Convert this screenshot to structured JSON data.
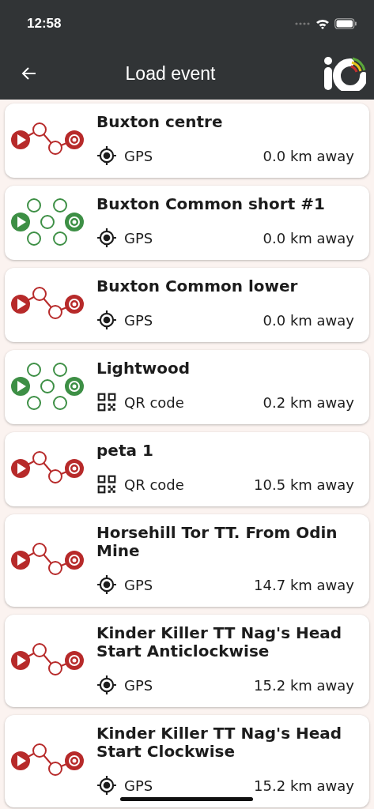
{
  "status_bar": {
    "time": "12:58"
  },
  "app_bar": {
    "title": "Load event"
  },
  "events": [
    {
      "kind": "linear",
      "name": "Buxton centre",
      "method": {
        "kind": "gps",
        "label": "GPS"
      },
      "distance": "0.0 km away"
    },
    {
      "kind": "score",
      "name": "Buxton Common short #1",
      "method": {
        "kind": "gps",
        "label": "GPS"
      },
      "distance": "0.0 km away"
    },
    {
      "kind": "linear",
      "name": "Buxton Common lower",
      "method": {
        "kind": "gps",
        "label": "GPS"
      },
      "distance": "0.0 km away"
    },
    {
      "kind": "score",
      "name": "Lightwood",
      "method": {
        "kind": "qr",
        "label": "QR code"
      },
      "distance": "0.2 km away"
    },
    {
      "kind": "linear",
      "name": "peta 1",
      "method": {
        "kind": "qr",
        "label": "QR code"
      },
      "distance": "10.5 km away"
    },
    {
      "kind": "linear",
      "name": "Horsehill Tor TT. From Odin Mine",
      "method": {
        "kind": "gps",
        "label": "GPS"
      },
      "distance": "14.7 km away"
    },
    {
      "kind": "linear",
      "name": "Kinder Killer TT Nag's Head Start Anticlockwise",
      "method": {
        "kind": "gps",
        "label": "GPS"
      },
      "distance": "15.2 km away"
    },
    {
      "kind": "linear",
      "name": "Kinder Killer TT Nag's Head Start Clockwise",
      "method": {
        "kind": "gps",
        "label": "GPS"
      },
      "distance": "15.2 km away"
    }
  ]
}
